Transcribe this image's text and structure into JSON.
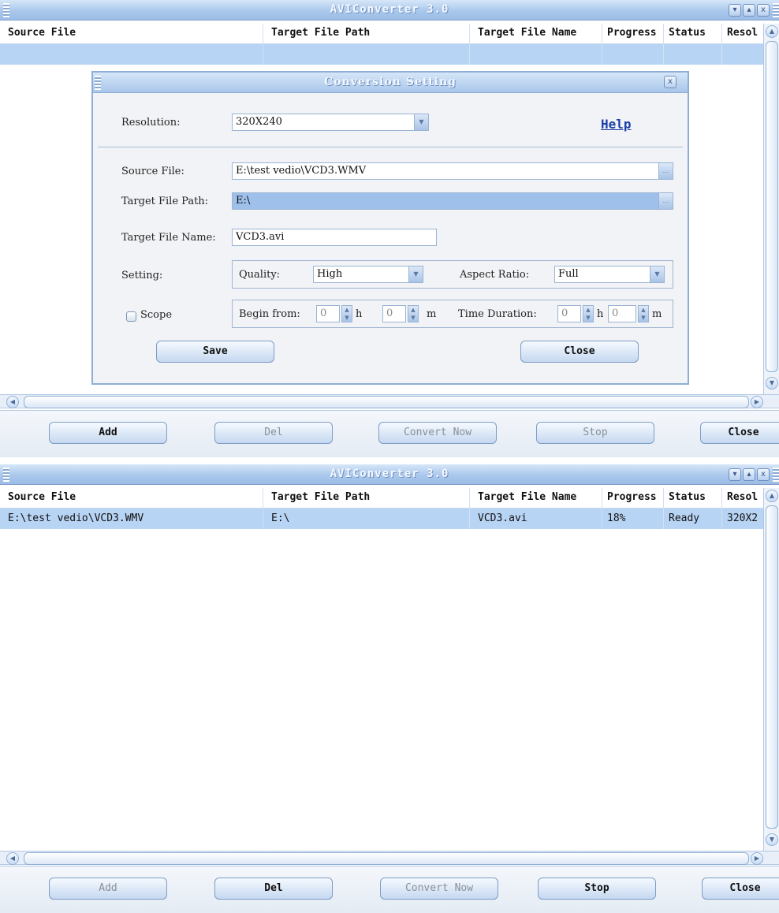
{
  "app_title": "AVIConverter 3.0",
  "window_buttons": {
    "minimize": "▾",
    "maximize": "▴",
    "close": "x"
  },
  "columns": [
    "Source File",
    "Target File Path",
    "Target File Name",
    "Progress",
    "Status",
    "Resol"
  ],
  "buttons": {
    "add": "Add",
    "del": "Del",
    "convert": "Convert Now",
    "stop": "Stop",
    "close": "Close"
  },
  "dialog": {
    "title": "Conversion Setting",
    "resolution_label": "Resolution:",
    "resolution_value": "320X240",
    "help": "Help",
    "source_label": "Source File:",
    "source_value": "E:\\test vedio\\VCD3.WMV",
    "target_path_label": "Target File Path:",
    "target_path_value": "E:\\",
    "target_name_label": "Target File Name:",
    "target_name_value": "VCD3.avi",
    "setting_label": "Setting:",
    "quality_label": "Quality:",
    "quality_value": "High",
    "aspect_label": "Aspect Ratio:",
    "aspect_value": "Full",
    "scope_label": "Scope",
    "begin_label": "Begin from:",
    "begin_h": "0",
    "h_unit": "h",
    "begin_m": "0",
    "m_unit": "m",
    "duration_label": "Time Duration:",
    "dur_h": "0",
    "dur_m": "0",
    "save": "Save",
    "close": "Close"
  },
  "row": {
    "source": "E:\\test vedio\\VCD3.WMV",
    "target_path": "E:\\",
    "target_name": "VCD3.avi",
    "progress": "18%",
    "status": "Ready",
    "resolution": "320X2"
  }
}
